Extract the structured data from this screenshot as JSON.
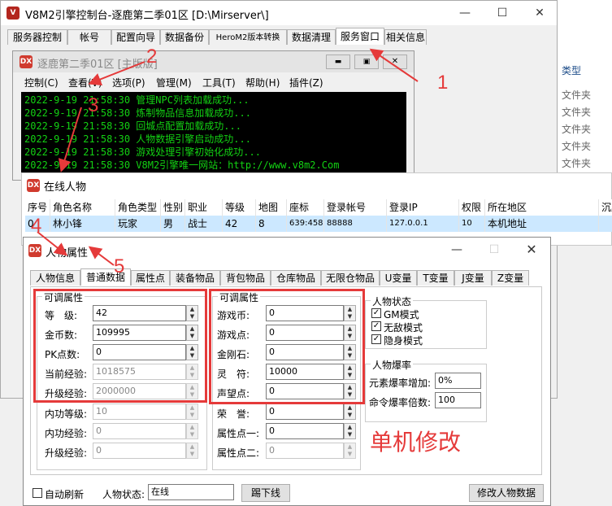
{
  "main_window": {
    "title": "V8M2引擎控制台-逐鹿第二季01区 [D:\\Mirserver\\]",
    "tabs": [
      "服务器控制",
      "帐号",
      "配置向导",
      "数据备份",
      "HeroM2版本转换",
      "数据清理",
      "服务窗口",
      "相关信息"
    ],
    "active_tab": "服务窗口"
  },
  "right_panel": {
    "header": "类型",
    "items": [
      "文件夹",
      "文件夹",
      "文件夹",
      "文件夹",
      "文件夹"
    ]
  },
  "server_window": {
    "title": "逐鹿第二季01区 [主版版]",
    "menu": [
      "控制(C)",
      "查看(V)",
      "选项(P)",
      "管理(M)",
      "工具(T)",
      "帮助(H)",
      "插件(Z)"
    ],
    "log": [
      "2022-9-19 21:58:30 管理NPC列表加载成功...",
      "2022-9-19 21:58:30 炼制物品信息加载成功...",
      "2022-9-19 21:58:30 回城点配置加载成功...",
      "2022-9-19 21:58:30 人物数据引擎启动成功...",
      "2022-9-19 21:58:30 游戏处理引擎初始化成功...",
      "2022-9-19 21:58:30 V8M2引擎唯一网站：http://www.v8m2.Com"
    ]
  },
  "online_window": {
    "title": "在线人物",
    "columns": [
      "序号",
      "角色名称",
      "角色类型",
      "性别",
      "职业",
      "等级",
      "地图",
      "座标",
      "登录帐号",
      "登录IP",
      "权限",
      "所在地区",
      "沉默"
    ],
    "row": [
      "0",
      "林小锋",
      "玩家",
      "男",
      "战士",
      "42",
      "8",
      "639:458",
      "88888",
      "127.0.0.1",
      "10",
      "本机地址",
      ""
    ]
  },
  "props_window": {
    "title": "人物属性",
    "tabs": [
      "人物信息",
      "普通数据",
      "属性点",
      "装备物品",
      "背包物品",
      "仓库物品",
      "无限仓物品",
      "U变量",
      "T变量",
      "J变量",
      "Z变量"
    ],
    "active_tab": "普通数据",
    "group1": {
      "title": "可调属性",
      "fields": [
        {
          "label": "等　级:",
          "value": "42",
          "disabled": false
        },
        {
          "label": "金币数:",
          "value": "109995",
          "disabled": false
        },
        {
          "label": "PK点数:",
          "value": "0",
          "disabled": false
        },
        {
          "label": "当前经验:",
          "value": "1018575",
          "disabled": true
        },
        {
          "label": "升级经验:",
          "value": "2000000",
          "disabled": true
        },
        {
          "label": "内功等级:",
          "value": "10",
          "disabled": true
        },
        {
          "label": "内功经验:",
          "value": "0",
          "disabled": true
        },
        {
          "label": "升级经验:",
          "value": "0",
          "disabled": true
        }
      ]
    },
    "group2": {
      "title": "可调属性",
      "fields": [
        {
          "label": "游戏币:",
          "value": "0",
          "disabled": false
        },
        {
          "label": "游戏点:",
          "value": "0",
          "disabled": false
        },
        {
          "label": "金刚石:",
          "value": "0",
          "disabled": false
        },
        {
          "label": "灵　符:",
          "value": "10000",
          "disabled": false
        },
        {
          "label": "声望点:",
          "value": "0",
          "disabled": false
        },
        {
          "label": "荣　誉:",
          "value": "0",
          "disabled": false
        },
        {
          "label": "属性点一:",
          "value": "0",
          "disabled": false
        },
        {
          "label": "属性点二:",
          "value": "0",
          "disabled": true
        }
      ]
    },
    "status_group": {
      "title": "人物状态",
      "checks": [
        {
          "label": "GM模式",
          "checked": true
        },
        {
          "label": "无敌模式",
          "checked": true
        },
        {
          "label": "隐身模式",
          "checked": true
        }
      ]
    },
    "drop_group": {
      "title": "人物爆率",
      "fields": [
        {
          "label": "元素爆率增加:",
          "value": "0%"
        },
        {
          "label": "命令爆率倍数:",
          "value": "100"
        }
      ]
    },
    "auto_refresh_label": "自动刷新",
    "status_label": "人物状态:",
    "status_value": "在线",
    "kick_button": "踢下线",
    "modify_button": "修改人物数据"
  },
  "annotations": {
    "n1": "1",
    "n2": "2",
    "n3": "3",
    "n4": "4",
    "n5": "5",
    "note": "单机修改",
    "color": "#e53a3a"
  },
  "colors": {
    "console_bg": "#000000",
    "console_text": "#13d113",
    "selected_row": "#cce8ff"
  }
}
